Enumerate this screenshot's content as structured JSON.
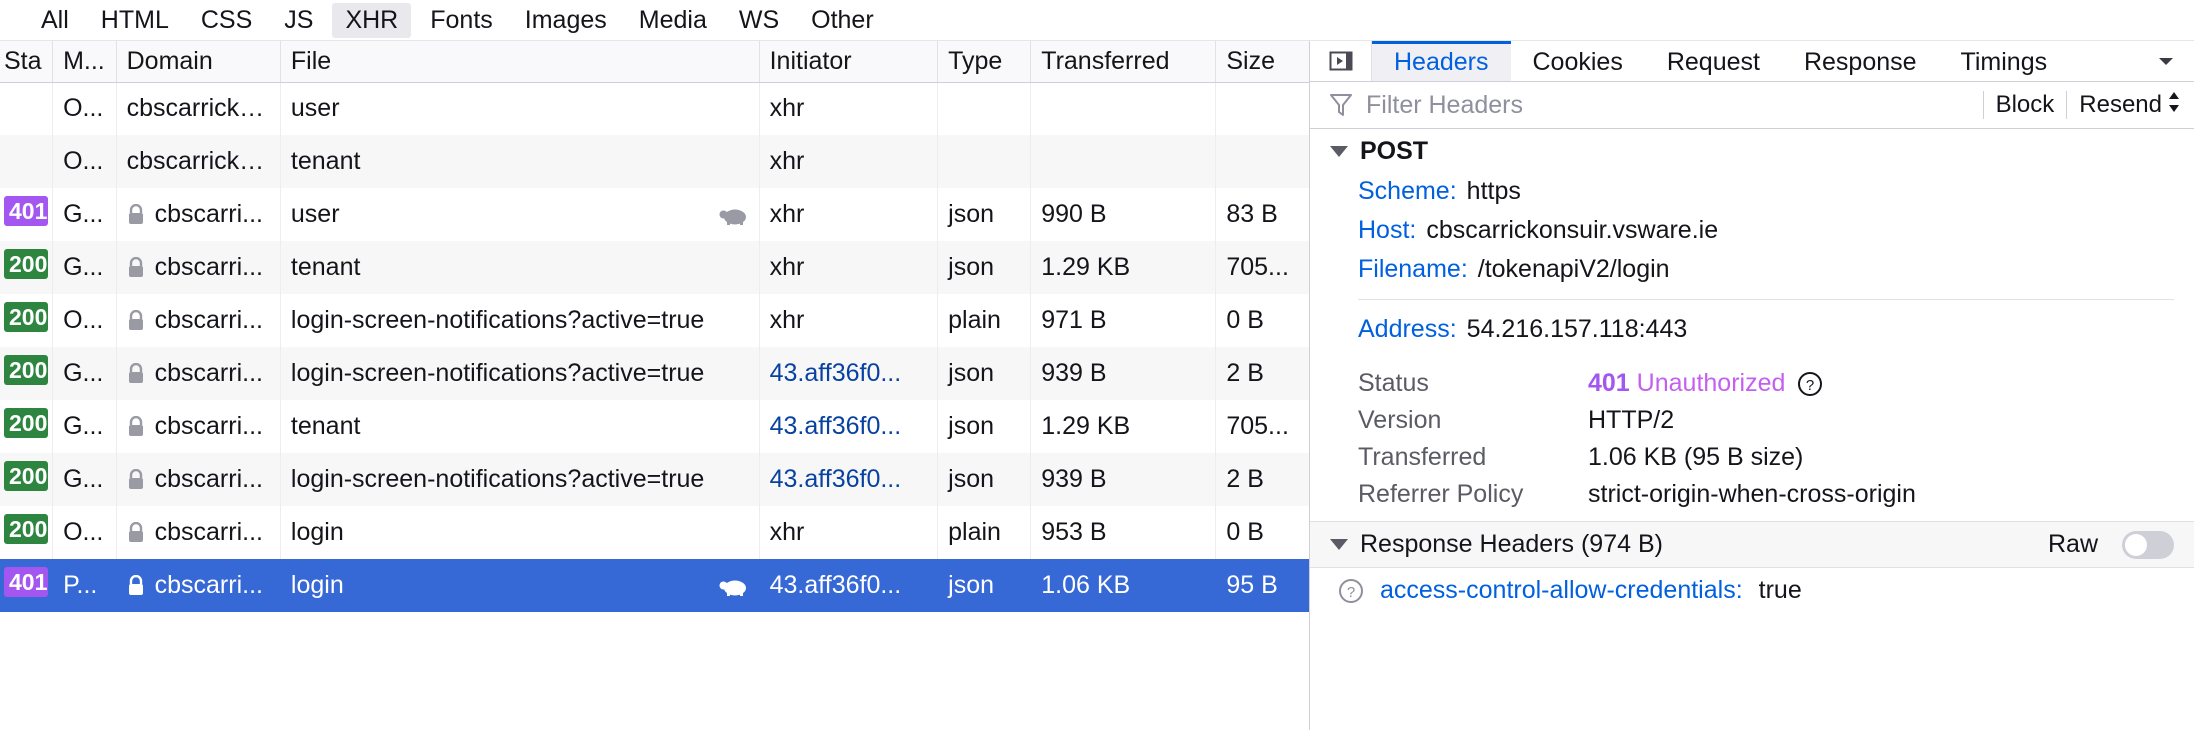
{
  "filter_bar": {
    "items": [
      {
        "label": "All",
        "active": false
      },
      {
        "label": "HTML",
        "active": false
      },
      {
        "label": "CSS",
        "active": false
      },
      {
        "label": "JS",
        "active": false
      },
      {
        "label": "XHR",
        "active": true
      },
      {
        "label": "Fonts",
        "active": false
      },
      {
        "label": "Images",
        "active": false
      },
      {
        "label": "Media",
        "active": false
      },
      {
        "label": "WS",
        "active": false
      },
      {
        "label": "Other",
        "active": false
      }
    ]
  },
  "network_table": {
    "columns": [
      "Sta",
      "M...",
      "Domain",
      "File",
      "Initiator",
      "Type",
      "Transferred",
      "Size"
    ],
    "rows": [
      {
        "status": "",
        "status_kind": "",
        "method": "O...",
        "secure": false,
        "domain": "cbscarricko...",
        "file": "user",
        "slow": false,
        "initiator": "xhr",
        "initiator_link": false,
        "type": "",
        "transferred": "",
        "size": "",
        "selected": false
      },
      {
        "status": "",
        "status_kind": "",
        "method": "O...",
        "secure": false,
        "domain": "cbscarricko...",
        "file": "tenant",
        "slow": false,
        "initiator": "xhr",
        "initiator_link": false,
        "type": "",
        "transferred": "",
        "size": "",
        "selected": false
      },
      {
        "status": "401",
        "status_kind": "401",
        "method": "G...",
        "secure": true,
        "domain": "cbscarri...",
        "file": "user",
        "slow": true,
        "initiator": "xhr",
        "initiator_link": false,
        "type": "json",
        "transferred": "990 B",
        "size": "83 B",
        "selected": false
      },
      {
        "status": "200",
        "status_kind": "200",
        "method": "G...",
        "secure": true,
        "domain": "cbscarri...",
        "file": "tenant",
        "slow": false,
        "initiator": "xhr",
        "initiator_link": false,
        "type": "json",
        "transferred": "1.29 KB",
        "size": "705...",
        "selected": false
      },
      {
        "status": "200",
        "status_kind": "200",
        "method": "O...",
        "secure": true,
        "domain": "cbscarri...",
        "file": "login-screen-notifications?active=true",
        "slow": false,
        "initiator": "xhr",
        "initiator_link": false,
        "type": "plain",
        "transferred": "971 B",
        "size": "0 B",
        "selected": false
      },
      {
        "status": "200",
        "status_kind": "200",
        "method": "G...",
        "secure": true,
        "domain": "cbscarri...",
        "file": "login-screen-notifications?active=true",
        "slow": false,
        "initiator": "43.aff36f0...",
        "initiator_link": true,
        "type": "json",
        "transferred": "939 B",
        "size": "2 B",
        "selected": false
      },
      {
        "status": "200",
        "status_kind": "200",
        "method": "G...",
        "secure": true,
        "domain": "cbscarri...",
        "file": "tenant",
        "slow": false,
        "initiator": "43.aff36f0...",
        "initiator_link": true,
        "type": "json",
        "transferred": "1.29 KB",
        "size": "705...",
        "selected": false
      },
      {
        "status": "200",
        "status_kind": "200",
        "method": "G...",
        "secure": true,
        "domain": "cbscarri...",
        "file": "login-screen-notifications?active=true",
        "slow": false,
        "initiator": "43.aff36f0...",
        "initiator_link": true,
        "type": "json",
        "transferred": "939 B",
        "size": "2 B",
        "selected": false
      },
      {
        "status": "200",
        "status_kind": "200",
        "method": "O...",
        "secure": true,
        "domain": "cbscarri...",
        "file": "login",
        "slow": false,
        "initiator": "xhr",
        "initiator_link": false,
        "type": "plain",
        "transferred": "953 B",
        "size": "0 B",
        "selected": false
      },
      {
        "status": "401",
        "status_kind": "401",
        "method": "P...",
        "secure": true,
        "domain": "cbscarri...",
        "file": "login",
        "slow": true,
        "initiator": "43.aff36f0...",
        "initiator_link": true,
        "type": "json",
        "transferred": "1.06 KB",
        "size": "95 B",
        "selected": true
      }
    ]
  },
  "details": {
    "tabs": [
      {
        "label": "Headers",
        "active": true
      },
      {
        "label": "Cookies",
        "active": false
      },
      {
        "label": "Request",
        "active": false
      },
      {
        "label": "Response",
        "active": false
      },
      {
        "label": "Timings",
        "active": false
      }
    ],
    "filter_placeholder": "Filter Headers",
    "filter_value": "",
    "block_label": "Block",
    "resend_label": "Resend",
    "request_section": {
      "title": "POST",
      "fields": [
        {
          "key": "Scheme:",
          "value": "https"
        },
        {
          "key": "Host:",
          "value": "cbscarrickonsuir.vsware.ie"
        },
        {
          "key": "Filename:",
          "value": "/tokenapiV2/login"
        }
      ],
      "address": {
        "key": "Address:",
        "value": "54.216.157.118:443"
      }
    },
    "meta": [
      {
        "label": "Status",
        "value": "401 Unauthorized",
        "status_code": "401",
        "status_text": "Unauthorized",
        "is_status": true
      },
      {
        "label": "Version",
        "value": "HTTP/2",
        "is_status": false
      },
      {
        "label": "Transferred",
        "value": "1.06 KB (95 B size)",
        "is_status": false
      },
      {
        "label": "Referrer Policy",
        "value": "strict-origin-when-cross-origin",
        "is_status": false
      }
    ],
    "response_headers": {
      "title": "Response Headers (974 B)",
      "raw_label": "Raw",
      "raw_on": false,
      "items": [
        {
          "name": "access-control-allow-credentials:",
          "value": "true"
        }
      ]
    }
  },
  "colors": {
    "accent": "#0060df",
    "selected_row": "#3668d6",
    "status_401": "#a456f0",
    "status_200": "#2e8540",
    "link": "#0842a0"
  }
}
